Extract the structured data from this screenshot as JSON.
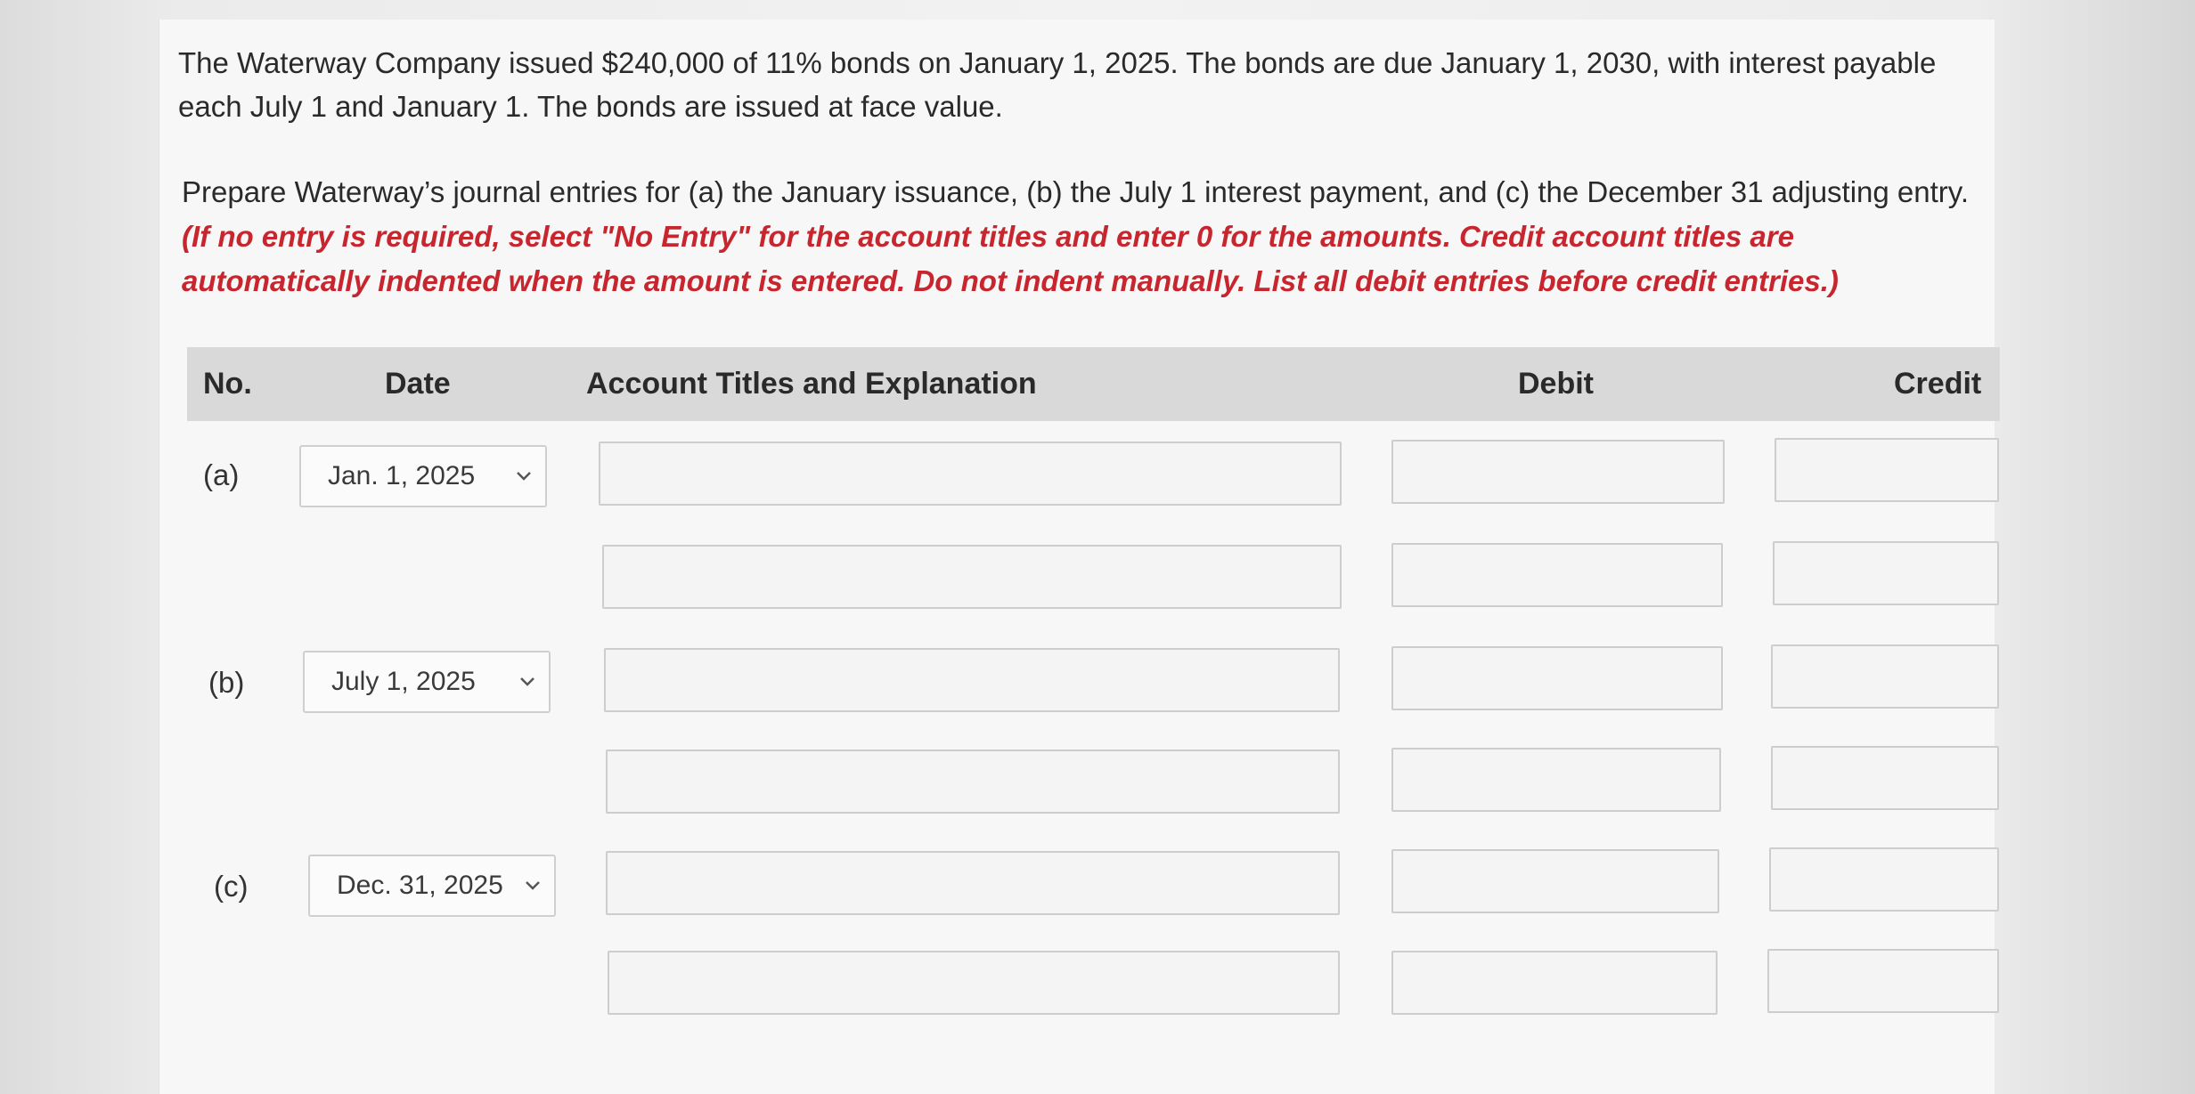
{
  "question": {
    "text": "The Waterway Company issued $240,000 of 11% bonds on January 1, 2025. The bonds are due January 1, 2030, with interest payable each July 1 and January 1. The bonds are issued at face value."
  },
  "instructions": {
    "text": "Prepare Waterway’s journal entries for (a) the January issuance, (b) the July 1 interest payment, and (c) the December 31 adjusting entry.",
    "note": "(If no entry is required, select \"No Entry\" for the account titles and enter 0 for the amounts. Credit account titles are automatically indented when the amount is entered. Do not indent manually. List all debit entries before credit entries.)",
    "note_color": "#c8262e"
  },
  "table": {
    "headers": {
      "no": "No.",
      "date": "Date",
      "account": "Account Titles and Explanation",
      "debit": "Debit",
      "credit": "Credit"
    },
    "rows": [
      {
        "no": "(a)",
        "date": "Jan. 1, 2025",
        "account": "",
        "debit": "",
        "credit": ""
      },
      {
        "no": "",
        "date": "",
        "account": "",
        "debit": "",
        "credit": ""
      },
      {
        "no": "(b)",
        "date": "July 1, 2025",
        "account": "",
        "debit": "",
        "credit": ""
      },
      {
        "no": "",
        "date": "",
        "account": "",
        "debit": "",
        "credit": ""
      },
      {
        "no": "(c)",
        "date": "Dec. 31, 2025",
        "account": "",
        "debit": "",
        "credit": ""
      },
      {
        "no": "",
        "date": "",
        "account": "",
        "debit": "",
        "credit": ""
      }
    ]
  },
  "icons": {
    "dropdown": "chevron-down-icon"
  }
}
